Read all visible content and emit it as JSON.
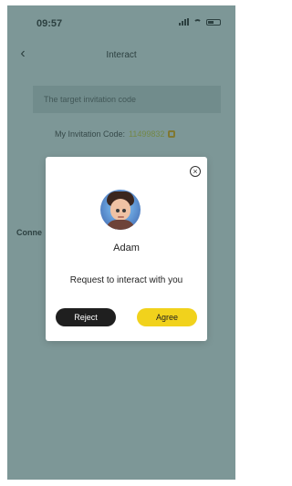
{
  "status_bar": {
    "time": "09:57",
    "icons": [
      "signal-icon",
      "wifi-icon",
      "battery-icon"
    ]
  },
  "nav_bar": {
    "title": "Interact",
    "back_icon": "chevron-left-icon"
  },
  "background": {
    "invite_placeholder": "The target invitation code",
    "my_code_label": "My Invitation Code:",
    "my_code_value": "11499832",
    "copy_icon": "copy-icon",
    "connect_label": "Conne"
  },
  "modal": {
    "close_icon": "close-circle-icon",
    "name": "Adam",
    "message": "Request to interact with you",
    "reject_label": "Reject",
    "agree_label": "Agree"
  },
  "colors": {
    "agree_button": "#f1d21c",
    "reject_button": "#1f1f1f",
    "overlay": "#9fb7b7",
    "code_value": "#91a34a"
  }
}
